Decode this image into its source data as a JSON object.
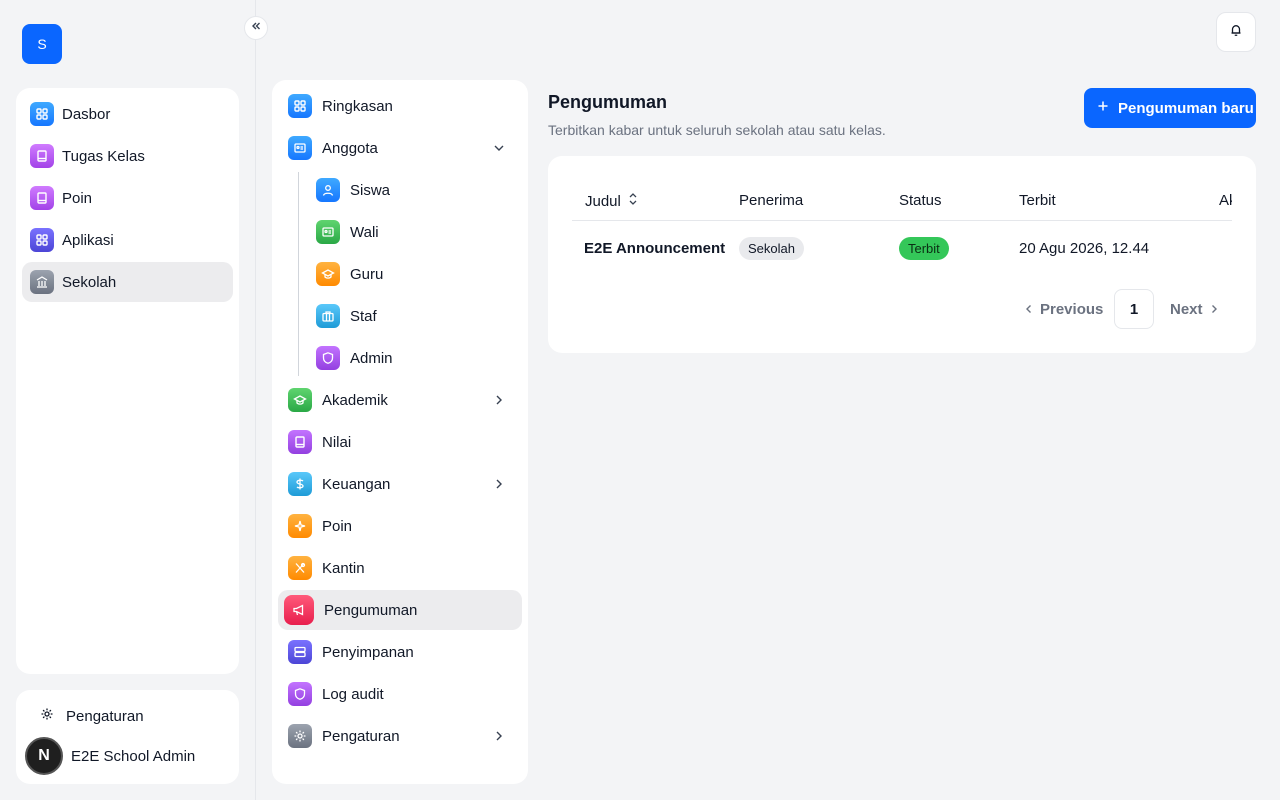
{
  "app": {
    "logo_letter": "S"
  },
  "rail": {
    "items": [
      {
        "label": "Dasbor",
        "icon": "grid-icon"
      },
      {
        "label": "Tugas Kelas",
        "icon": "book-icon"
      },
      {
        "label": "Poin",
        "icon": "book-icon"
      },
      {
        "label": "Aplikasi",
        "icon": "grid-icon"
      },
      {
        "label": "Sekolah",
        "icon": "building-icon",
        "active": true
      }
    ],
    "settings_label": "Pengaturan",
    "user_name": "E2E School Admin",
    "avatar_letter": "N"
  },
  "section_nav": {
    "items": [
      {
        "label": "Ringkasan",
        "icon": "grid-icon"
      },
      {
        "label": "Anggota",
        "icon": "id-card-icon",
        "expanded": true
      },
      {
        "label": "Siswa",
        "icon": "person-icon"
      },
      {
        "label": "Wali",
        "icon": "id-card-icon"
      },
      {
        "label": "Guru",
        "icon": "graduation-cap-icon"
      },
      {
        "label": "Staf",
        "icon": "briefcase-icon"
      },
      {
        "label": "Admin",
        "icon": "shield-icon"
      },
      {
        "label": "Akademik",
        "icon": "graduation-cap-icon"
      },
      {
        "label": "Nilai",
        "icon": "book-icon"
      },
      {
        "label": "Keuangan",
        "icon": "dollar-icon"
      },
      {
        "label": "Poin",
        "icon": "sparkle-icon"
      },
      {
        "label": "Kantin",
        "icon": "utensils-icon"
      },
      {
        "label": "Pengumuman",
        "icon": "megaphone-icon",
        "active": true
      },
      {
        "label": "Penyimpanan",
        "icon": "server-icon"
      },
      {
        "label": "Log audit",
        "icon": "shield-icon"
      },
      {
        "label": "Pengaturan",
        "icon": "gear-icon"
      }
    ]
  },
  "main": {
    "title": "Pengumuman",
    "subtitle": "Terbitkan kabar untuk seluruh sekolah atau satu kelas.",
    "new_button": "Pengumuman baru",
    "table": {
      "headers": [
        "Judul",
        "Penerima",
        "Status",
        "Terbit",
        "Ak"
      ],
      "rows": [
        {
          "title": "E2E Announcement",
          "recipient": "Sekolah",
          "status": "Terbit",
          "published": "20 Agu 2026, 12.44"
        }
      ]
    },
    "pagination": {
      "previous": "Previous",
      "page": "1",
      "next": "Next"
    }
  }
}
